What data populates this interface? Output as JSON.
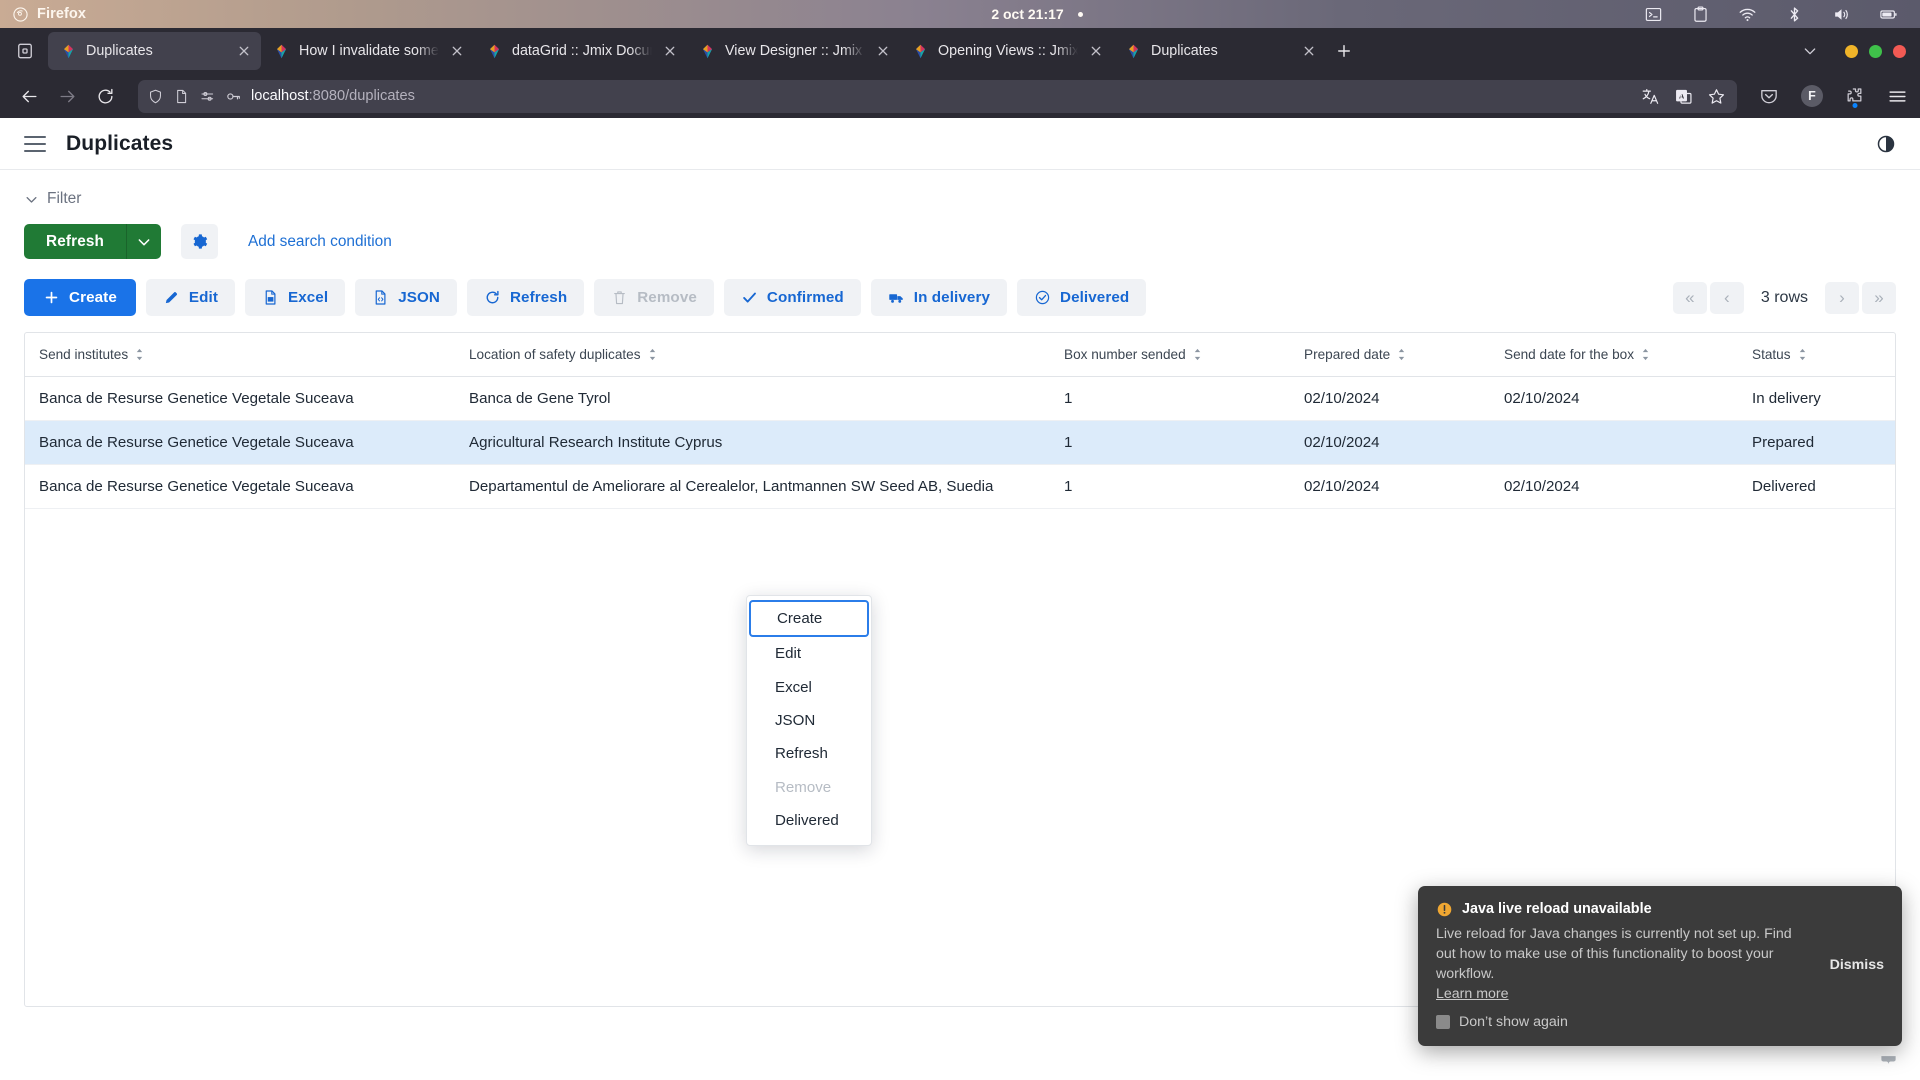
{
  "os": {
    "app_name": "Firefox",
    "clock": "2 oct 21:17",
    "tray_icons": [
      "terminal-icon",
      "clipboard-icon",
      "wifi-icon",
      "bluetooth-icon",
      "volume-icon",
      "battery-icon"
    ],
    "window_buttons": [
      "minimize-button",
      "maximize-button",
      "close-button"
    ]
  },
  "browser": {
    "tabs": [
      {
        "title": "Duplicates",
        "active": true
      },
      {
        "title": "How I invalidate some items",
        "active": false
      },
      {
        "title": "dataGrid :: Jmix Documentation",
        "active": false
      },
      {
        "title": "View Designer :: Jmix Documentation",
        "active": false
      },
      {
        "title": "Opening Views :: Jmix Documentation",
        "active": false
      },
      {
        "title": "Duplicates",
        "active": false
      }
    ],
    "url_host": "localhost",
    "url_path": ":8080/duplicates",
    "profile_initial": "F"
  },
  "app": {
    "title": "Duplicates",
    "filter": {
      "label": "Filter",
      "refresh_label": "Refresh",
      "add_condition_label": "Add search condition"
    },
    "toolbar": {
      "buttons": [
        {
          "label": "Create",
          "icon": "plus-icon",
          "style": "primary",
          "disabled": false
        },
        {
          "label": "Edit",
          "icon": "pencil-icon",
          "style": "default",
          "disabled": false
        },
        {
          "label": "Excel",
          "icon": "excel-icon",
          "style": "default",
          "disabled": false
        },
        {
          "label": "JSON",
          "icon": "json-icon",
          "style": "default",
          "disabled": false
        },
        {
          "label": "Refresh",
          "icon": "refresh-icon",
          "style": "default",
          "disabled": false
        },
        {
          "label": "Remove",
          "icon": "trash-icon",
          "style": "default",
          "disabled": true
        },
        {
          "label": "Confirmed",
          "icon": "check-icon",
          "style": "default",
          "disabled": false
        },
        {
          "label": "In delivery",
          "icon": "truck-icon",
          "style": "default",
          "disabled": false
        },
        {
          "label": "Delivered",
          "icon": "check-circle-icon",
          "style": "default",
          "disabled": false
        }
      ],
      "pager": {
        "first": "«",
        "prev": "‹",
        "rows": "3 rows",
        "next": "›",
        "last": "»"
      }
    },
    "grid": {
      "columns": [
        "Send institutes",
        "Location of safety duplicates",
        "Box number sended",
        "Prepared date",
        "Send date for the box",
        "Status"
      ],
      "rows": [
        {
          "send_institutes": "Banca de Resurse Genetice Vegetale Suceava",
          "location": "Banca de Gene Tyrol",
          "box_number": "1",
          "prepared_date": "02/10/2024",
          "send_date": "02/10/2024",
          "status": "In delivery",
          "selected": false
        },
        {
          "send_institutes": "Banca de Resurse Genetice Vegetale Suceava",
          "location": "Agricultural Research Institute Cyprus",
          "box_number": "1",
          "prepared_date": "02/10/2024",
          "send_date": "",
          "status": "Prepared",
          "selected": true
        },
        {
          "send_institutes": "Banca de Resurse Genetice Vegetale Suceava",
          "location": "Departamentul de Ameliorare al Cerealelor, Lantmannen SW Seed AB, Suedia",
          "box_number": "1",
          "prepared_date": "02/10/2024",
          "send_date": "02/10/2024",
          "status": "Delivered",
          "selected": false
        }
      ]
    },
    "context_menu": {
      "items": [
        {
          "label": "Create",
          "highlighted": true,
          "disabled": false
        },
        {
          "label": "Edit",
          "highlighted": false,
          "disabled": false
        },
        {
          "label": "Excel",
          "highlighted": false,
          "disabled": false
        },
        {
          "label": "JSON",
          "highlighted": false,
          "disabled": false
        },
        {
          "label": "Refresh",
          "highlighted": false,
          "disabled": false
        },
        {
          "label": "Remove",
          "highlighted": false,
          "disabled": true
        },
        {
          "label": "Delivered",
          "highlighted": false,
          "disabled": false
        }
      ]
    },
    "toast": {
      "title": "Java live reload unavailable",
      "message": "Live reload for Java changes is currently not set up. Find out how to make use of this functionality to boost your workflow.",
      "link": "Learn more",
      "checkbox_label": "Don’t show again",
      "dismiss_label": "Dismiss"
    }
  },
  "colors": {
    "accent_blue": "#1a73e8",
    "link_blue": "#1767d2",
    "green": "#207a35",
    "selected_row": "#dcebfa",
    "toast_bg": "#3b3b3b",
    "warn_orange": "#f0a732"
  }
}
